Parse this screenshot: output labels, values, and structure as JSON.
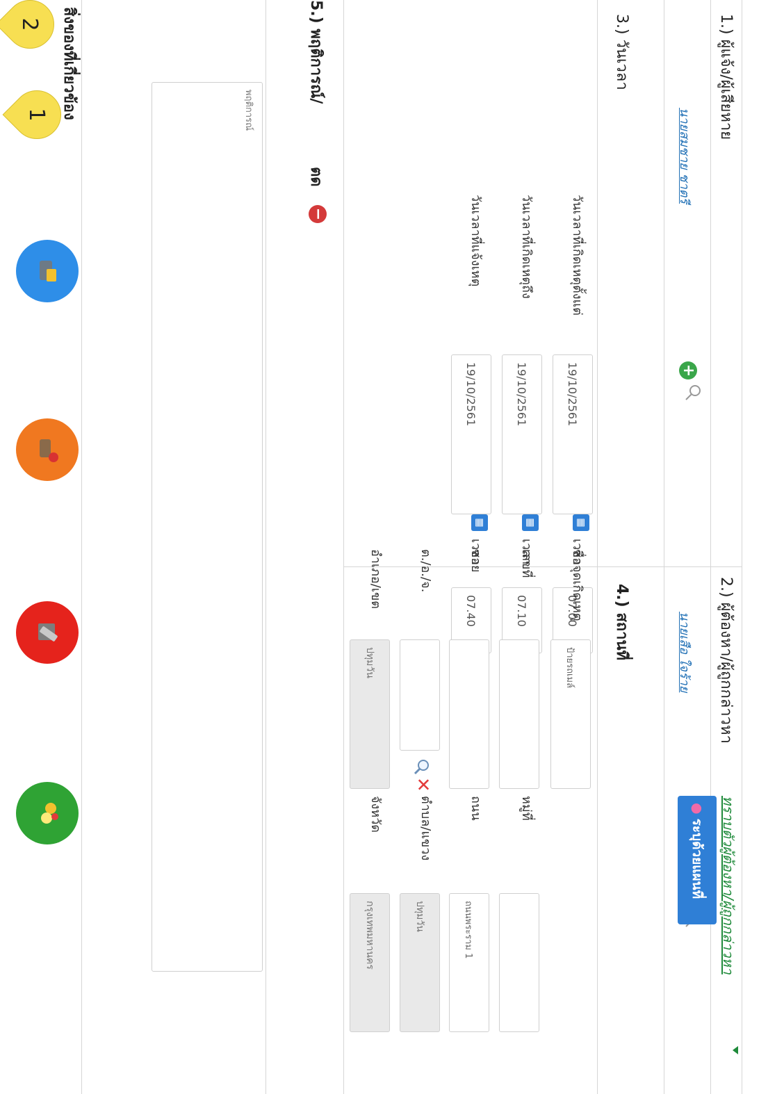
{
  "victim": {
    "title": "1.) ผู้แจ้ง/ผู้เสียหาย",
    "name": "นายสมชาย ชาตรี"
  },
  "suspect": {
    "title": "2.) ผู้ต้องหา/ผู้ถูกกล่าวหา",
    "name": "นายเสือ ใจร้าย",
    "known_link": "ทราบตัวผู้ต้องหา/ผู้ถูกกล่าวหา"
  },
  "datetime": {
    "title": "3.) วันเวลา",
    "time_label": "เวลา",
    "rows": [
      {
        "label": "วันเวลาที่เกิดเหตุตั้งแต่",
        "date": "19/10/2561",
        "time": "07.00"
      },
      {
        "label": "วันเวลาที่เกิดเหตุถึง",
        "date": "19/10/2561",
        "time": "07.10"
      },
      {
        "label": "วันเวลาที่แจ้งเหตุ",
        "date": "19/10/2561",
        "time": "07.40"
      }
    ]
  },
  "place": {
    "title": "4.) สถานที่",
    "spot_label": "ชื่อจุดเกิดเหตุ",
    "spot_value": "ป้ายรถเมล์",
    "map_button": "ระบุด้วยแผนที่",
    "house_no_label": "เลขที่",
    "house_no_value": "",
    "moo_label": "หมู่ที่",
    "moo_value": "",
    "soi_label": "ซอย",
    "soi_value": "",
    "road_label": "ถนน",
    "road_value": "ถนนพระราม 1",
    "tao_label": "ต./อ./จ.",
    "tao_value": "",
    "subdistrict_label": "ตำบล/แขวง",
    "subdistrict_value": "ปทุมวัน",
    "district_label": "อำเภอ/เขต",
    "district_value": "ปทุมวัน",
    "province_label": "จังหวัด",
    "province_value": "กรุงเทพมหานคร"
  },
  "behavior": {
    "title": "5.) พฤติการณ์/",
    "title_tail": "ตด",
    "placeholder": "พฤติการณ์"
  },
  "items": {
    "title": "สิ่งของที่เกี่ยวข้อง"
  },
  "callouts": [
    "1",
    "2"
  ],
  "icons": {
    "add": "plus-circle-icon",
    "search": "magnifier-icon",
    "calendar": "calendar-icon",
    "clock": "clock-icon",
    "map_pin": "map-pin-icon",
    "remove": "minus-circle-icon",
    "clear": "x-icon",
    "item_categories": [
      "blue-item-icon",
      "orange-item-icon",
      "red-item-icon",
      "green-item-icon"
    ]
  },
  "colors": {
    "link": "#1f6fb5",
    "green_link": "#1e8a3a",
    "button_blue": "#2f7fd6",
    "add_green": "#3aa64a",
    "remove_red": "#d43a3a",
    "callout_yellow": "#f7df52"
  }
}
